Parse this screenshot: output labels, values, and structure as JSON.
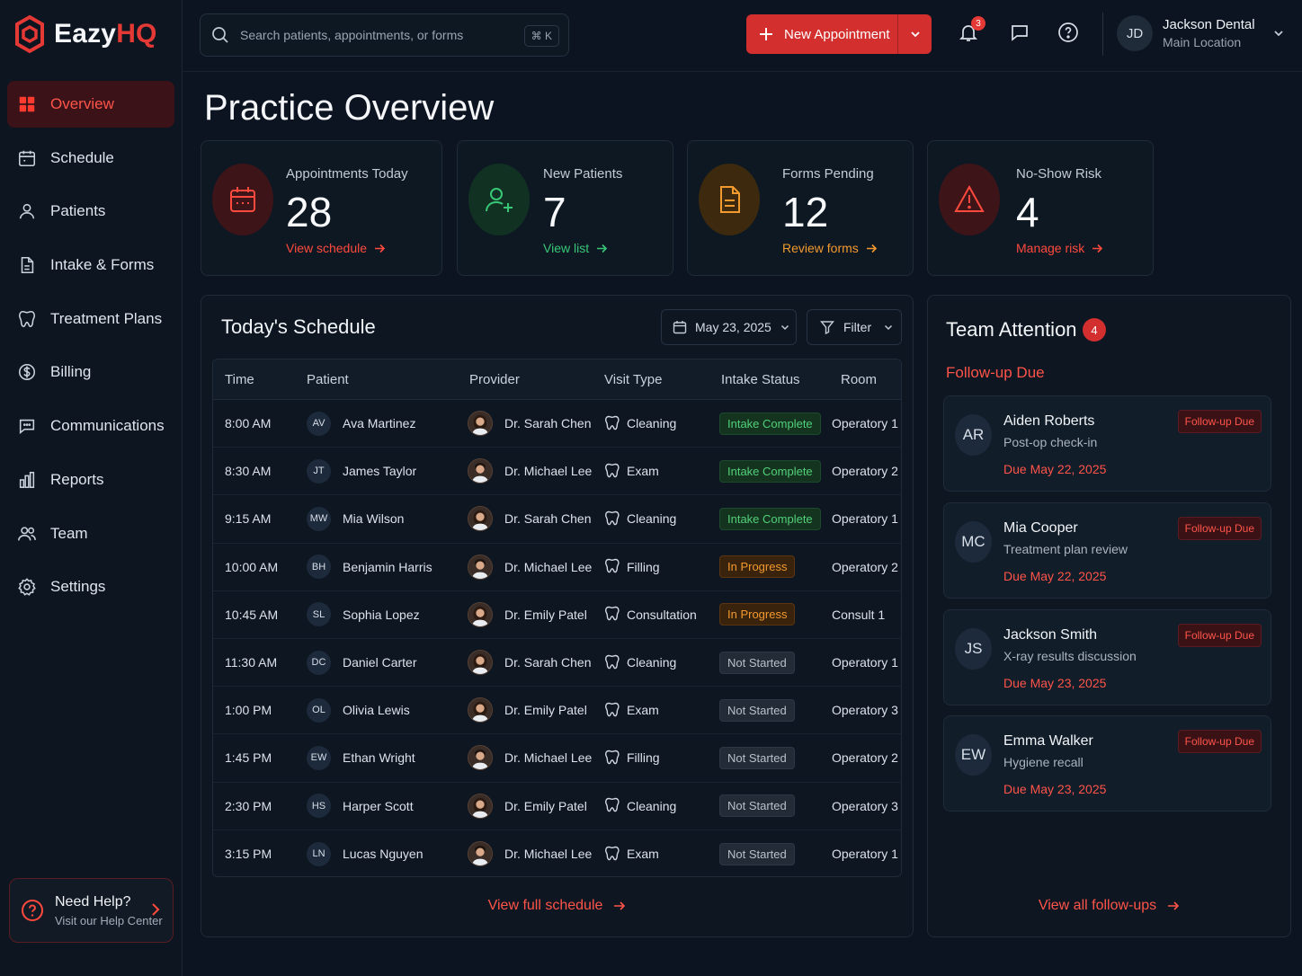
{
  "brand": {
    "name_part1": "Eazy",
    "name_part2": "HQ",
    "accent": "#e53935"
  },
  "sidebar": {
    "items": [
      {
        "label": "Overview",
        "icon": "grid-icon",
        "active": true
      },
      {
        "label": "Schedule",
        "icon": "calendar-icon",
        "active": false
      },
      {
        "label": "Patients",
        "icon": "user-icon",
        "active": false
      },
      {
        "label": "Intake & Forms",
        "icon": "document-icon",
        "active": false
      },
      {
        "label": "Treatment Plans",
        "icon": "tooth-icon",
        "active": false
      },
      {
        "label": "Billing",
        "icon": "dollar-icon",
        "active": false
      },
      {
        "label": "Communications",
        "icon": "chat-icon",
        "active": false
      },
      {
        "label": "Reports",
        "icon": "bar-chart-icon",
        "active": false
      },
      {
        "label": "Team",
        "icon": "team-icon",
        "active": false
      },
      {
        "label": "Settings",
        "icon": "gear-icon",
        "active": false
      }
    ],
    "help": {
      "title": "Need Help?",
      "subtitle": "Visit our Help Center"
    }
  },
  "topbar": {
    "search_placeholder": "Search patients, appointments, or forms",
    "shortcut": "⌘ K",
    "new_appointment": "New Appointment",
    "notification_count": "3",
    "user": {
      "initials": "JD",
      "name": "Jackson Dental",
      "location": "Main Location"
    }
  },
  "page": {
    "title": "Practice Overview"
  },
  "stats": [
    {
      "label": "Appointments Today",
      "value": "28",
      "link": "View schedule",
      "color": "#ff4a3d",
      "circle": "#3d1418",
      "icon": "calendar-icon"
    },
    {
      "label": "New Patients",
      "value": "7",
      "link": "View list",
      "color": "#38c777",
      "circle": "#113222",
      "icon": "add-user-icon"
    },
    {
      "label": "Forms Pending",
      "value": "12",
      "link": "Review forms",
      "color": "#f29a2e",
      "circle": "#3d2a0e",
      "icon": "document-icon"
    },
    {
      "label": "No-Show Risk",
      "value": "4",
      "link": "Manage risk",
      "color": "#ff4a3d",
      "circle": "#3d1418",
      "icon": "warning-icon"
    }
  ],
  "schedule": {
    "title": "Today's Schedule",
    "date": "May 23, 2025",
    "filter": "Filter",
    "columns": [
      "Time",
      "Patient",
      "Provider",
      "Visit Type",
      "Intake Status",
      "Room"
    ],
    "rows": [
      {
        "time": "8:00 AM",
        "initials": "AV",
        "patient": "Ava Martinez",
        "provider": "Dr. Sarah Chen",
        "visit": "Cleaning",
        "status": "Intake Complete",
        "status_kind": "complete",
        "room": "Operatory 1"
      },
      {
        "time": "8:30 AM",
        "initials": "JT",
        "patient": "James Taylor",
        "provider": "Dr. Michael Lee",
        "visit": "Exam",
        "status": "Intake Complete",
        "status_kind": "complete",
        "room": "Operatory 2"
      },
      {
        "time": "9:15 AM",
        "initials": "MW",
        "patient": "Mia Wilson",
        "provider": "Dr. Sarah Chen",
        "visit": "Cleaning",
        "status": "Intake Complete",
        "status_kind": "complete",
        "room": "Operatory 1"
      },
      {
        "time": "10:00 AM",
        "initials": "BH",
        "patient": "Benjamin Harris",
        "provider": "Dr. Michael Lee",
        "visit": "Filling",
        "status": "In Progress",
        "status_kind": "progress",
        "room": "Operatory 2"
      },
      {
        "time": "10:45 AM",
        "initials": "SL",
        "patient": "Sophia Lopez",
        "provider": "Dr. Emily Patel",
        "visit": "Consultation",
        "status": "In Progress",
        "status_kind": "progress",
        "room": "Consult 1"
      },
      {
        "time": "11:30 AM",
        "initials": "DC",
        "patient": "Daniel Carter",
        "provider": "Dr. Sarah Chen",
        "visit": "Cleaning",
        "status": "Not Started",
        "status_kind": "notstarted",
        "room": "Operatory 1"
      },
      {
        "time": "1:00 PM",
        "initials": "OL",
        "patient": "Olivia Lewis",
        "provider": "Dr. Emily Patel",
        "visit": "Exam",
        "status": "Not Started",
        "status_kind": "notstarted",
        "room": "Operatory 3"
      },
      {
        "time": "1:45 PM",
        "initials": "EW",
        "patient": "Ethan Wright",
        "provider": "Dr. Michael Lee",
        "visit": "Filling",
        "status": "Not Started",
        "status_kind": "notstarted",
        "room": "Operatory 2"
      },
      {
        "time": "2:30 PM",
        "initials": "HS",
        "patient": "Harper Scott",
        "provider": "Dr. Emily Patel",
        "visit": "Cleaning",
        "status": "Not Started",
        "status_kind": "notstarted",
        "room": "Operatory 3"
      },
      {
        "time": "3:15 PM",
        "initials": "LN",
        "patient": "Lucas Nguyen",
        "provider": "Dr. Michael Lee",
        "visit": "Exam",
        "status": "Not Started",
        "status_kind": "notstarted",
        "room": "Operatory 1"
      }
    ],
    "view_full": "View full schedule"
  },
  "team": {
    "title": "Team Attention",
    "count": "4",
    "section": "Follow-up Due",
    "items": [
      {
        "initials": "AR",
        "name": "Aiden Roberts",
        "desc": "Post-op check-in",
        "due": "Due May 22, 2025",
        "badge": "Follow-up Due"
      },
      {
        "initials": "MC",
        "name": "Mia Cooper",
        "desc": "Treatment plan review",
        "due": "Due May 22, 2025",
        "badge": "Follow-up Due"
      },
      {
        "initials": "JS",
        "name": "Jackson Smith",
        "desc": "X-ray results discussion",
        "due": "Due May 23, 2025",
        "badge": "Follow-up Due"
      },
      {
        "initials": "EW",
        "name": "Emma Walker",
        "desc": "Hygiene recall",
        "due": "Due May 23, 2025",
        "badge": "Follow-up Due"
      }
    ],
    "view_all": "View all follow-ups"
  }
}
